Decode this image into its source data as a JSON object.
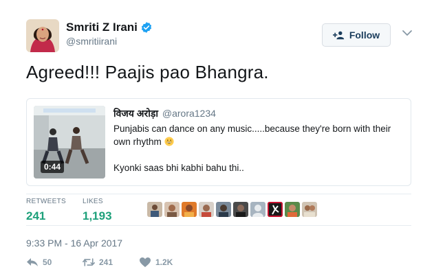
{
  "user": {
    "name": "Smriti Z Irani",
    "handle": "@smritiirani"
  },
  "header": {
    "follow_label": "Follow"
  },
  "tweet": {
    "text": "Agreed!!! Paajis pao Bhangra."
  },
  "quote": {
    "author_name": "विजय अरोड़ा",
    "author_handle": "@arora1234",
    "line1": "Punjabis can dance on any music.....because they're born with their own rhythm",
    "line2": "Kyonki saas bhi kabhi bahu thi..",
    "video_duration": "0:44"
  },
  "stats": {
    "retweets_label": "RETWEETS",
    "retweets_value": "241",
    "likes_label": "LIKES",
    "likes_value": "1,193"
  },
  "timestamp": "9:33 PM - 16 Apr 2017",
  "actions": {
    "reply_count": "50",
    "retweet_count": "241",
    "like_count": "1.2K"
  },
  "colors": {
    "verified": "#1da1f2",
    "stat_value": "#1da07a",
    "muted": "#657786",
    "action": "#8899a6"
  }
}
